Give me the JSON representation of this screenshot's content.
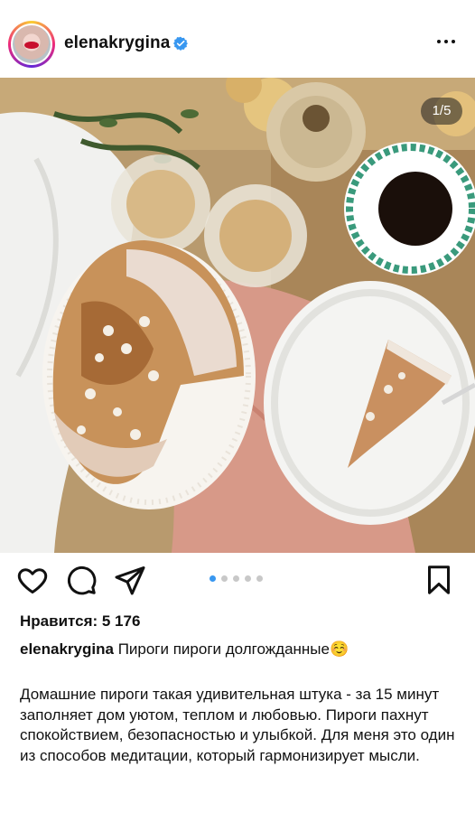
{
  "post": {
    "username": "elenakrygina",
    "image_counter": "1/5",
    "likes": "Нравится: 5 176",
    "caption_username": "elenakrygina",
    "caption_title": "Пироги пироги долгожданные☺️",
    "body": "Домашние пироги такая удивительная штука - за 15 минут заполняет дом уютом, теплом и любовью. Пироги пахнут спокойствием, безопасностью и улыбкой. Для меня это один из способов медитации, который гармонизирует мысли."
  },
  "carousel": {
    "total": 5,
    "current": 1
  },
  "icons": [
    "verified-badge-icon",
    "more-options-icon",
    "heart-icon",
    "comment-icon",
    "share-icon",
    "bookmark-icon"
  ],
  "colors": {
    "verified": "#3897f0",
    "carousel_active": "#3897f0",
    "carousel_inactive": "#c8c8c8"
  }
}
